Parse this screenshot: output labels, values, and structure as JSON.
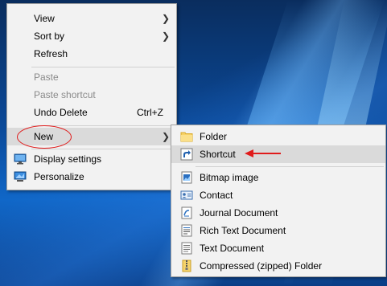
{
  "context_menu": {
    "items": [
      {
        "label": "View",
        "has_submenu": true
      },
      {
        "label": "Sort by",
        "has_submenu": true
      },
      {
        "label": "Refresh"
      },
      {
        "label": "Paste",
        "disabled": true
      },
      {
        "label": "Paste shortcut",
        "disabled": true
      },
      {
        "label": "Undo Delete",
        "shortcut": "Ctrl+Z"
      },
      {
        "label": "New",
        "has_submenu": true,
        "highlighted": true
      },
      {
        "label": "Display settings",
        "icon": "display-icon"
      },
      {
        "label": "Personalize",
        "icon": "personalize-icon"
      }
    ]
  },
  "new_submenu": {
    "items": [
      {
        "label": "Folder",
        "icon": "folder-icon"
      },
      {
        "label": "Shortcut",
        "icon": "shortcut-icon",
        "highlighted": true
      },
      {
        "label": "Bitmap image",
        "icon": "bitmap-icon"
      },
      {
        "label": "Contact",
        "icon": "contact-icon"
      },
      {
        "label": "Journal Document",
        "icon": "journal-icon"
      },
      {
        "label": "Rich Text Document",
        "icon": "rich-text-icon"
      },
      {
        "label": "Text Document",
        "icon": "text-document-icon"
      },
      {
        "label": "Compressed (zipped) Folder",
        "icon": "zip-folder-icon"
      }
    ]
  },
  "annotations": {
    "color": "#e01b1b"
  }
}
